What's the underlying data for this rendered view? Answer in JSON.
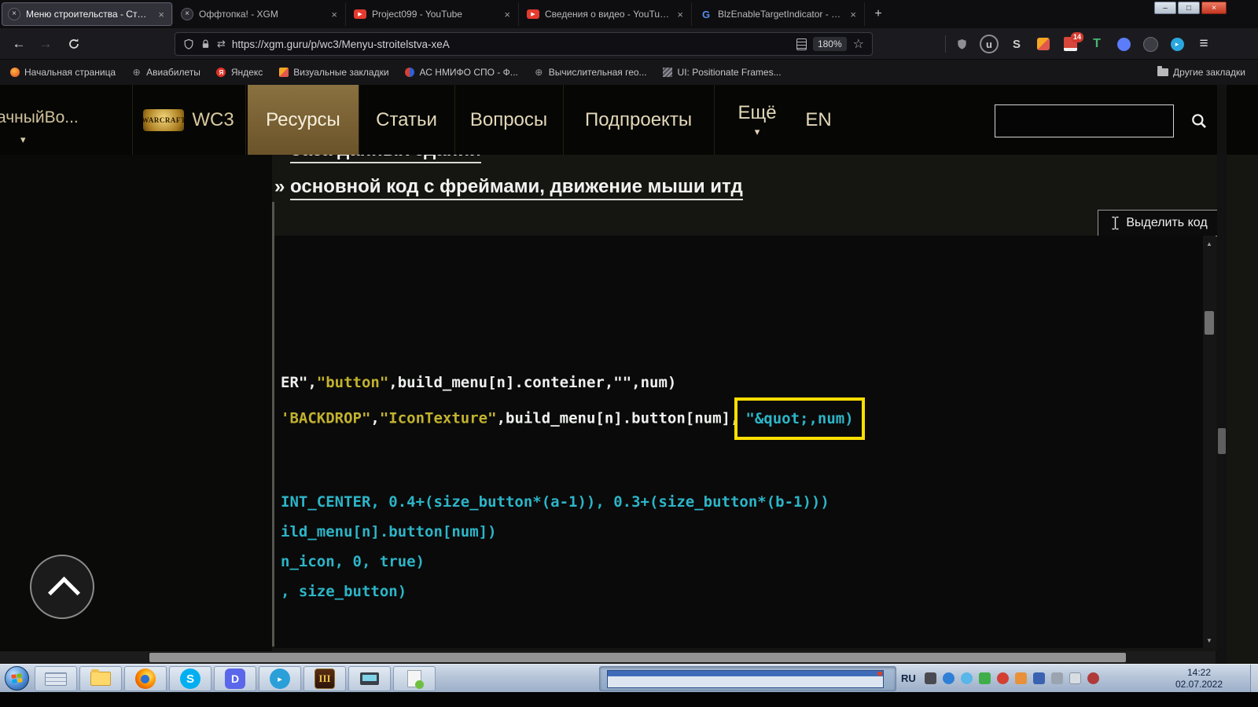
{
  "icons": {
    "chevron_down": "▾",
    "triangle_up": "▲",
    "triangle_down": "▼",
    "star": "☆",
    "menu": "≡",
    "back": "←",
    "forward": "→",
    "close": "×",
    "plus": "+",
    "globe": "⊕",
    "play": "▶",
    "yandex_letter": "Я",
    "google_letter": "G",
    "ublock_letter": "u",
    "s_letter": "S",
    "t_letter": "T",
    "telegram_glyph": "▸",
    "skype_letter": "S",
    "discord_letter": "D",
    "wc3_glyph": "III",
    "minimize": "–",
    "maximize": "□"
  },
  "browser": {
    "tabs": [
      {
        "title": "Меню строительства - Статьи"
      },
      {
        "title": "Оффтопка! - XGM"
      },
      {
        "title": "Project099 - YouTube"
      },
      {
        "title": "Сведения о видео - YouTube St"
      },
      {
        "title": "BlzEnableTargetIndicator - Пои"
      }
    ],
    "url": "https://xgm.guru/p/wc3/Menyu-stroitelstva-xeA",
    "zoom": "180%",
    "extension_badge": "14",
    "bookmarks": {
      "items": [
        "Начальная страница",
        "Авиабилеты",
        "Яндекс",
        "Визуальные закладки",
        "АС НМИФО СПО - Ф...",
        "Вычислительная гео...",
        "UI: Positionate Frames..."
      ],
      "other": "Другие закладки"
    }
  },
  "site": {
    "user_menu": "ачныйВо...",
    "logo_small": "WARCRAFT",
    "logo": "WC3",
    "nav": {
      "resources": "Ресурсы",
      "articles": "Статьи",
      "questions": "Вопросы",
      "subprojects": "Подпроекты",
      "more": "Ещё",
      "lang": "EN"
    }
  },
  "page": {
    "heading_top": {
      "marker": "»",
      "text": "база данных зданий"
    },
    "heading": {
      "marker": "»",
      "text": "основной код с фреймами, движение мыши итд"
    },
    "select_code": "Выделить код",
    "code": {
      "l5": {
        "a": "ER\",",
        "b": "\"button\"",
        "c": ",build_menu[n].conteiner,\"\",num)"
      },
      "l6": {
        "a": "'BACKDROP\"",
        "b": ",",
        "c": "\"IconTexture\"",
        "d": ",build_menu[n].button[num],",
        "e": "\"&quot;,num)"
      },
      "l9": "INT_CENTER, 0.4+(size_button*(a-1)), 0.3+(size_button*(b-1)))",
      "l10": "ild_menu[n].button[num])",
      "l11": "n_icon, 0, true)",
      "l12": ", size_button)"
    },
    "colors": {
      "code_string": "#c2b22e",
      "code_plain": "#eef0ee",
      "code_cyan": "#2cb5c8",
      "highlight_box": "#ffdf00",
      "nav_active_bg": "#7a6233"
    }
  },
  "taskbar": {
    "language": "RU",
    "time": "14:22",
    "date": "02.07.2022"
  }
}
